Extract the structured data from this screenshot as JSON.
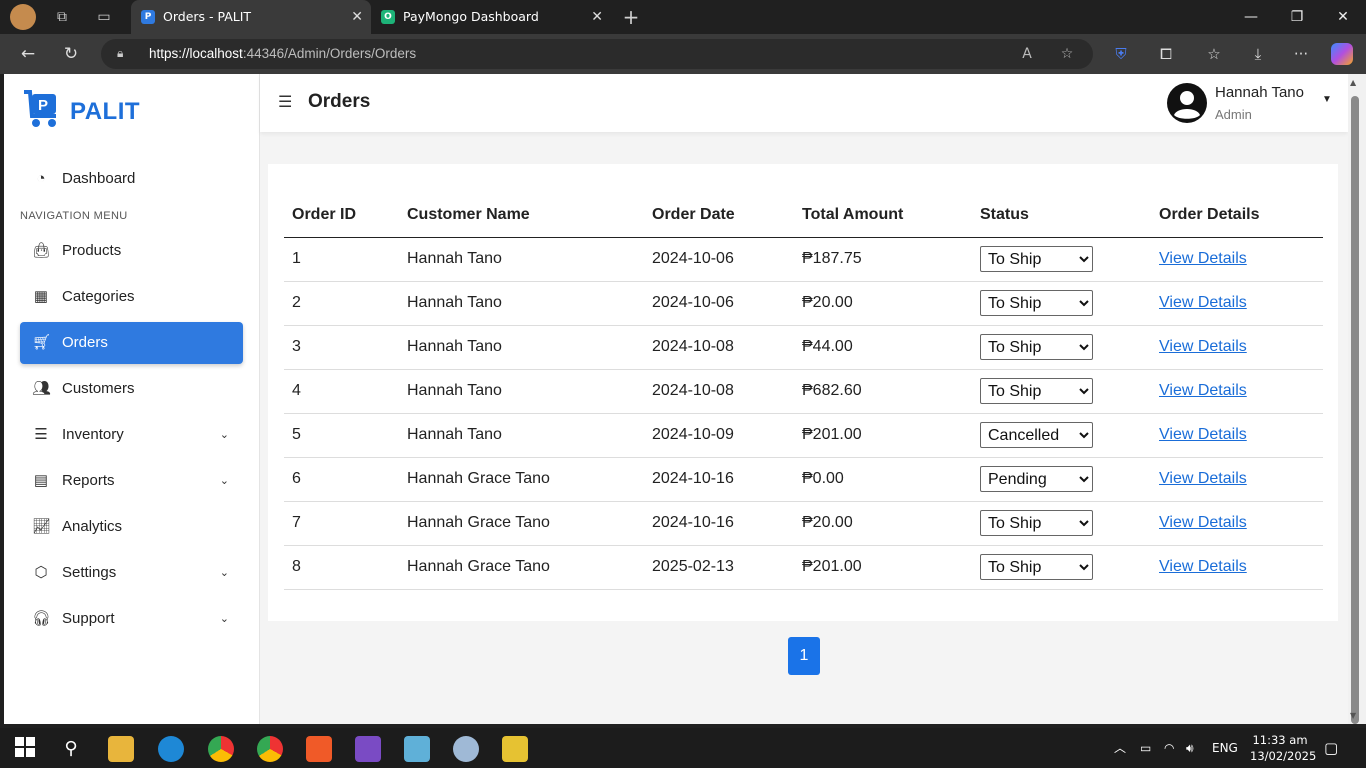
{
  "browser": {
    "tabs": [
      {
        "title": "Orders - PALIT",
        "favicon": "P"
      },
      {
        "title": "PayMongo Dashboard",
        "favicon": "O"
      }
    ],
    "url_host": "https://localhost",
    "url_rest": ":44346/Admin/Orders/Orders"
  },
  "sidebar": {
    "brand": "PALIT",
    "dashboard": "Dashboard",
    "nav_header": "NAVIGATION MENU",
    "items": [
      {
        "label": "Products",
        "icon": "bag-icon"
      },
      {
        "label": "Categories",
        "icon": "grid-icon"
      },
      {
        "label": "Orders",
        "icon": "cart-icon"
      },
      {
        "label": "Customers",
        "icon": "people-icon"
      },
      {
        "label": "Inventory",
        "icon": "list-icon"
      },
      {
        "label": "Reports",
        "icon": "report-icon"
      },
      {
        "label": "Analytics",
        "icon": "chart-icon"
      },
      {
        "label": "Settings",
        "icon": "settings-icon"
      },
      {
        "label": "Support",
        "icon": "headset-icon"
      }
    ]
  },
  "topbar": {
    "title": "Orders",
    "user_name": "Hannah Tano",
    "user_role": "Admin"
  },
  "table": {
    "headers": [
      "Order ID",
      "Customer Name",
      "Order Date",
      "Total Amount",
      "Status",
      "Order Details"
    ],
    "link_label": "View Details",
    "status_options": [
      "Pending",
      "To Ship",
      "Cancelled"
    ],
    "rows": [
      {
        "id": "1",
        "customer": "Hannah Tano",
        "date": "2024-10-06",
        "amount": "₱187.75",
        "status": "To Ship"
      },
      {
        "id": "2",
        "customer": "Hannah Tano",
        "date": "2024-10-06",
        "amount": "₱20.00",
        "status": "To Ship"
      },
      {
        "id": "3",
        "customer": "Hannah Tano",
        "date": "2024-10-08",
        "amount": "₱44.00",
        "status": "To Ship"
      },
      {
        "id": "4",
        "customer": "Hannah Tano",
        "date": "2024-10-08",
        "amount": "₱682.60",
        "status": "To Ship"
      },
      {
        "id": "5",
        "customer": "Hannah Tano",
        "date": "2024-10-09",
        "amount": "₱201.00",
        "status": "Cancelled"
      },
      {
        "id": "6",
        "customer": "Hannah Grace Tano",
        "date": "2024-10-16",
        "amount": "₱0.00",
        "status": "Pending"
      },
      {
        "id": "7",
        "customer": "Hannah Grace Tano",
        "date": "2024-10-16",
        "amount": "₱20.00",
        "status": "To Ship"
      },
      {
        "id": "8",
        "customer": "Hannah Grace Tano",
        "date": "2025-02-13",
        "amount": "₱201.00",
        "status": "To Ship"
      }
    ]
  },
  "pagination": {
    "current": "1"
  },
  "taskbar": {
    "lang": "ENG",
    "time": "11:33 am",
    "date": "13/02/2025"
  },
  "colors": {
    "accent": "#2f7ae0",
    "link": "#1a6dd8",
    "brand": "#1e6fd9"
  }
}
